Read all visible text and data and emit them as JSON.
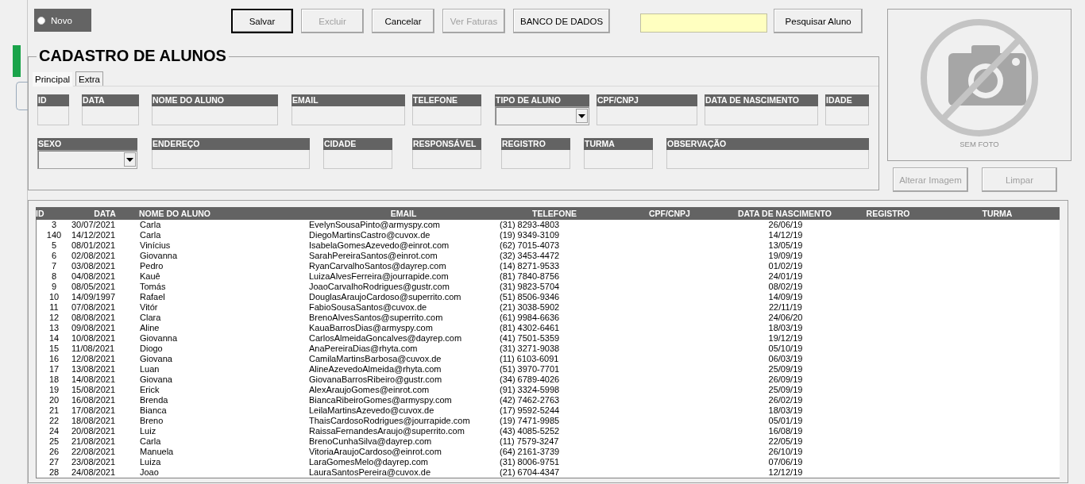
{
  "toolbar": {
    "new_option": {
      "label": "Novo",
      "selected": false
    },
    "buttons": [
      {
        "label": "Salvar",
        "disabled": false,
        "default": true
      },
      {
        "label": "Excluir",
        "disabled": true,
        "default": false
      },
      {
        "label": "Cancelar",
        "disabled": false,
        "default": false
      },
      {
        "label": "Ver Faturas",
        "disabled": true,
        "default": false
      },
      {
        "label": "BANCO DE DADOS",
        "disabled": false,
        "default": false
      }
    ],
    "search": {
      "button": "Pesquisar Aluno"
    }
  },
  "form": {
    "title": "CADASTRO DE ALUNOS",
    "tabs": [
      {
        "label": "Principal",
        "selected": true
      },
      {
        "label": "Extra",
        "selected": false
      }
    ],
    "fields": [
      {
        "label": "ID",
        "kind": "text"
      },
      {
        "label": "DATA",
        "kind": "text"
      },
      {
        "label": "NOME DO ALUNO",
        "kind": "text"
      },
      {
        "label": "EMAIL",
        "kind": "text"
      },
      {
        "label": "TELEFONE",
        "kind": "text"
      },
      {
        "label": "TIPO DE ALUNO",
        "kind": "dropdown"
      },
      {
        "label": "CPF/CNPJ",
        "kind": "text"
      },
      {
        "label": "DATA DE NASCIMENTO",
        "kind": "text"
      },
      {
        "label": "IDADE",
        "kind": "text"
      },
      {
        "label": "SEXO",
        "kind": "dropdown"
      },
      {
        "label": "ENDEREÇO",
        "kind": "text"
      },
      {
        "label": "CIDADE",
        "kind": "text"
      },
      {
        "label": "RESPONSÁVEL",
        "kind": "text"
      },
      {
        "label": "REGISTRO",
        "kind": "text"
      },
      {
        "label": "TURMA",
        "kind": "text"
      },
      {
        "label": "OBSERVAÇÃO",
        "kind": "text"
      }
    ]
  },
  "photo": {
    "caption": "SEM FOTO",
    "buttons": [
      {
        "label": "Alterar Imagem",
        "disabled": true
      },
      {
        "label": "Limpar",
        "disabled": true
      }
    ]
  },
  "table": {
    "columns": [
      "ID",
      "DATA",
      "NOME DO ALUNO",
      "EMAIL",
      "TELEFONE",
      "CPF/CNPJ",
      "DATA DE NASCIMENTO",
      "REGISTRO",
      "TURMA"
    ],
    "rows": [
      [
        "3",
        "30/07/2021",
        "Carla",
        "EvelynSousaPinto@armyspy.com",
        "(31) 8293-4803",
        "",
        "26/06/19",
        "",
        ""
      ],
      [
        "140",
        "14/12/2021",
        "Carla",
        "DiegoMartinsCastro@cuvox.de",
        "(19) 9349-3109",
        "",
        "14/12/19",
        "",
        ""
      ],
      [
        "5",
        "08/01/2021",
        "Vinícius",
        "IsabelaGomesAzevedo@einrot.com",
        "(62) 7015-4073",
        "",
        "13/05/19",
        "",
        ""
      ],
      [
        "6",
        "02/08/2021",
        "Giovanna",
        "SarahPereiraSantos@einrot.com",
        "(32) 3453-4472",
        "",
        "19/09/19",
        "",
        ""
      ],
      [
        "7",
        "03/08/2021",
        "Pedro",
        "RyanCarvalhoSantos@dayrep.com",
        "(14) 8271-9533",
        "",
        "01/02/19",
        "",
        ""
      ],
      [
        "8",
        "04/08/2021",
        "Kauê",
        "LuizaAlvesFerreira@jourrapide.com",
        "(81) 7840-8756",
        "",
        "24/01/19",
        "",
        ""
      ],
      [
        "9",
        "08/05/2021",
        "Tomás",
        "JoaoCarvalhoRodrigues@gustr.com",
        "(31) 9823-5704",
        "",
        "08/02/19",
        "",
        ""
      ],
      [
        "10",
        "14/09/1997",
        "Rafael",
        "DouglasAraujoCardoso@superrito.com",
        "(51) 8506-9346",
        "",
        "14/09/19",
        "",
        ""
      ],
      [
        "11",
        "07/08/2021",
        "Vitór",
        "FabioSousaSantos@cuvox.de",
        "(21) 3038-5902",
        "",
        "22/11/19",
        "",
        ""
      ],
      [
        "12",
        "08/08/2021",
        "Clara",
        "BrenoAlvesSantos@superrito.com",
        "(61) 9984-6636",
        "",
        "24/06/20",
        "",
        ""
      ],
      [
        "13",
        "09/08/2021",
        "Aline",
        "KauaBarrosDias@armyspy.com",
        "(81) 4302-6461",
        "",
        "18/03/19",
        "",
        ""
      ],
      [
        "14",
        "10/08/2021",
        "Giovanna",
        "CarlosAlmeidaGoncalves@dayrep.com",
        "(41) 7501-5359",
        "",
        "19/12/19",
        "",
        ""
      ],
      [
        "15",
        "11/08/2021",
        "Diogo",
        "AnaPereiraDias@rhyta.com",
        "(31) 3271-9038",
        "",
        "05/10/19",
        "",
        ""
      ],
      [
        "16",
        "12/08/2021",
        "Giovana",
        "CamilaMartinsBarbosa@cuvox.de",
        "(11) 6103-6091",
        "",
        "06/03/19",
        "",
        ""
      ],
      [
        "17",
        "13/08/2021",
        "Luan",
        "AlineAzevedoAlmeida@rhyta.com",
        "(51) 3970-7701",
        "",
        "25/09/19",
        "",
        ""
      ],
      [
        "18",
        "14/08/2021",
        "Giovana",
        "GiovanaBarrosRibeiro@gustr.com",
        "(34) 6789-4026",
        "",
        "26/09/19",
        "",
        ""
      ],
      [
        "19",
        "15/08/2021",
        "Erick",
        "AlexAraujoGomes@einrot.com",
        "(91) 3324-5998",
        "",
        "25/09/19",
        "",
        ""
      ],
      [
        "20",
        "16/08/2021",
        "Brenda",
        "BiancaRibeiroGomes@armyspy.com",
        "(42) 7462-2763",
        "",
        "26/02/19",
        "",
        ""
      ],
      [
        "21",
        "17/08/2021",
        "Bianca",
        "LeilaMartinsAzevedo@cuvox.de",
        "(17) 9592-5244",
        "",
        "18/03/19",
        "",
        ""
      ],
      [
        "22",
        "18/08/2021",
        "Breno",
        "ThaisCardosoRodrigues@jourrapide.com",
        "(19) 7471-9985",
        "",
        "05/01/19",
        "",
        ""
      ],
      [
        "24",
        "20/08/2021",
        "Luiz",
        "RaissaFernandesAraujo@superrito.com",
        "(43) 4085-5252",
        "",
        "16/08/19",
        "",
        ""
      ],
      [
        "25",
        "21/08/2021",
        "Carla",
        "BrenoCunhaSilva@dayrep.com",
        "(11) 7579-3247",
        "",
        "22/05/19",
        "",
        ""
      ],
      [
        "26",
        "22/08/2021",
        "Manuela",
        "VitoriaAraujoCardoso@einrot.com",
        "(64) 2161-3739",
        "",
        "26/10/19",
        "",
        ""
      ],
      [
        "27",
        "23/08/2021",
        "Luiza",
        "LaraGomesMelo@dayrep.com",
        "(31) 8006-9751",
        "",
        "07/06/19",
        "",
        ""
      ],
      [
        "28",
        "24/08/2021",
        "Joao",
        "LauraSantosPereira@cuvox.de",
        "(21) 6704-4347",
        "",
        "12/12/19",
        "",
        ""
      ]
    ]
  }
}
